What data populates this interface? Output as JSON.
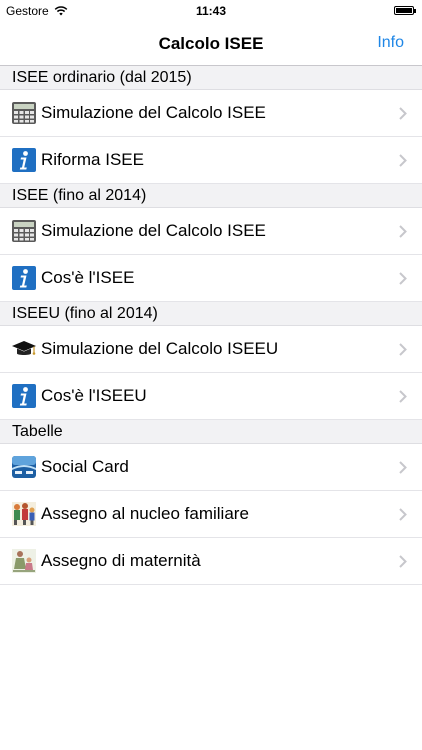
{
  "status_bar": {
    "carrier": "Gestore",
    "time": "11:43"
  },
  "nav": {
    "title": "Calcolo ISEE",
    "info_label": "Info"
  },
  "sections": [
    {
      "header": "ISEE ordinario (dal 2015)",
      "rows": [
        {
          "label": "Simulazione del Calcolo ISEE",
          "icon": "calculator-icon"
        },
        {
          "label": "Riforma ISEE",
          "icon": "info-icon"
        }
      ]
    },
    {
      "header": "ISEE (fino al 2014)",
      "rows": [
        {
          "label": "Simulazione del Calcolo ISEE",
          "icon": "calculator-icon"
        },
        {
          "label": "Cos'è l'ISEE",
          "icon": "info-icon"
        }
      ]
    },
    {
      "header": "ISEEU (fino al 2014)",
      "rows": [
        {
          "label": "Simulazione del Calcolo ISEEU",
          "icon": "graduation-cap-icon"
        },
        {
          "label": "Cos'è l'ISEEU",
          "icon": "info-icon"
        }
      ]
    },
    {
      "header": "Tabelle",
      "rows": [
        {
          "label": "Social Card",
          "icon": "social-card-icon"
        },
        {
          "label": "Assegno al nucleo familiare",
          "icon": "family-icon"
        },
        {
          "label": "Assegno di maternità",
          "icon": "maternity-icon"
        }
      ]
    }
  ],
  "colors": {
    "accent": "#1e86e6",
    "section_bg": "#f2f2f4",
    "separator": "#e4e4e8",
    "chevron": "#c7c7cc"
  }
}
